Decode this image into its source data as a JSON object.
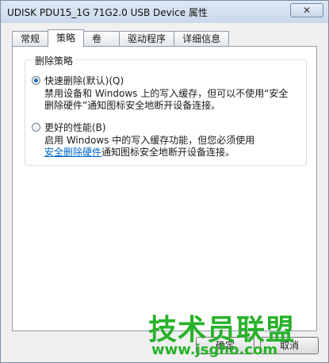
{
  "window": {
    "title": "UDISK PDU15_1G 71G2.0 USB Device 属性",
    "close_label": "✕"
  },
  "tabs": [
    {
      "label": "常规"
    },
    {
      "label": "策略"
    },
    {
      "label": "卷"
    },
    {
      "label": "驱动程序"
    },
    {
      "label": "详细信息"
    }
  ],
  "active_tab": "策略",
  "removal_policy": {
    "group_title": "删除策略",
    "quick_removal": {
      "label": "快速删除(默认)(Q)",
      "checked": true,
      "desc_line1": "禁用设备和 Windows 上的写入缓存，但可以不使用“安全",
      "desc_line2": "删除硬件”通知图标安全地断开设备连接。"
    },
    "better_performance": {
      "label": "更好的性能(B)",
      "checked": false,
      "desc_line1": "启用 Windows 中的写入缓存功能，但您必须使用",
      "desc_link": "安全删除硬件",
      "desc_line2_rest": "通知图标安全地断开设备连接。"
    }
  },
  "buttons": {
    "ok": "确定",
    "cancel": "取消"
  },
  "watermark": {
    "text": "技术员联盟",
    "url": "www.jsgho.com"
  }
}
